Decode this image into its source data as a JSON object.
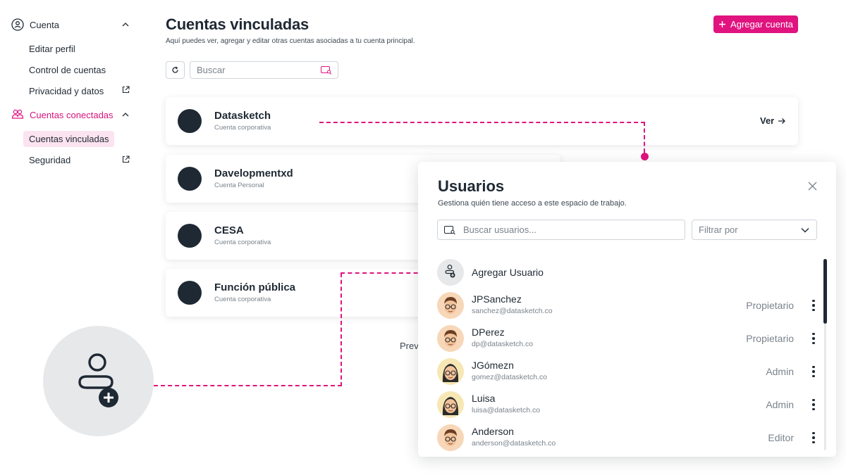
{
  "sidebar": {
    "section1": {
      "label": "Cuenta"
    },
    "links1": [
      "Editar perfil",
      "Control de cuentas",
      "Privacidad y datos"
    ],
    "section2": {
      "label": "Cuentas conectadas"
    },
    "links2": [
      "Cuentas vinculadas",
      "Seguridad"
    ]
  },
  "header": {
    "title": "Cuentas vinculadas",
    "subtitle": "Aquí puedes ver, agregar y editar otras cuentas asociadas a tu cuenta principal.",
    "add_button": "Agregar cuenta",
    "search_placeholder": "Buscar"
  },
  "accounts": [
    {
      "name": "Datasketch",
      "type": "Cuenta corporativa"
    },
    {
      "name": "Davelopmentxd",
      "type": "Cuenta Personal"
    },
    {
      "name": "CESA",
      "type": "Cuenta corporativa"
    },
    {
      "name": "Función pública",
      "type": "Cuenta corporativa"
    }
  ],
  "view_link": "Ver",
  "pagination_fragment": "Prev",
  "users_panel": {
    "title": "Usuarios",
    "subtitle": "Gestiona quién tiene acceso a este espacio de trabajo.",
    "search_placeholder": "Buscar usuarios...",
    "filter_label": "Filtrar por",
    "add_user_label": "Agregar Usuario",
    "users": [
      {
        "name": "JPSanchez",
        "email": "sanchez@datasketch.co",
        "role": "Propietario",
        "avatar": "man-glasses"
      },
      {
        "name": "DPerez",
        "email": "dp@datasketch.co",
        "role": "Propietario",
        "avatar": "man-glasses"
      },
      {
        "name": "JGómezn",
        "email": "gomez@datasketch.co",
        "role": "Admin",
        "avatar": "woman-glasses"
      },
      {
        "name": "Luisa",
        "email": "luisa@datasketch.co",
        "role": "Admin",
        "avatar": "woman-glasses"
      },
      {
        "name": "Anderson",
        "email": "anderson@datasketch.co",
        "role": "Editor",
        "avatar": "man-glasses"
      }
    ]
  },
  "colors": {
    "accent": "#e0137f",
    "accent_soft": "#fbe3ef",
    "dark": "#1f2933",
    "muted": "#7a838c"
  }
}
